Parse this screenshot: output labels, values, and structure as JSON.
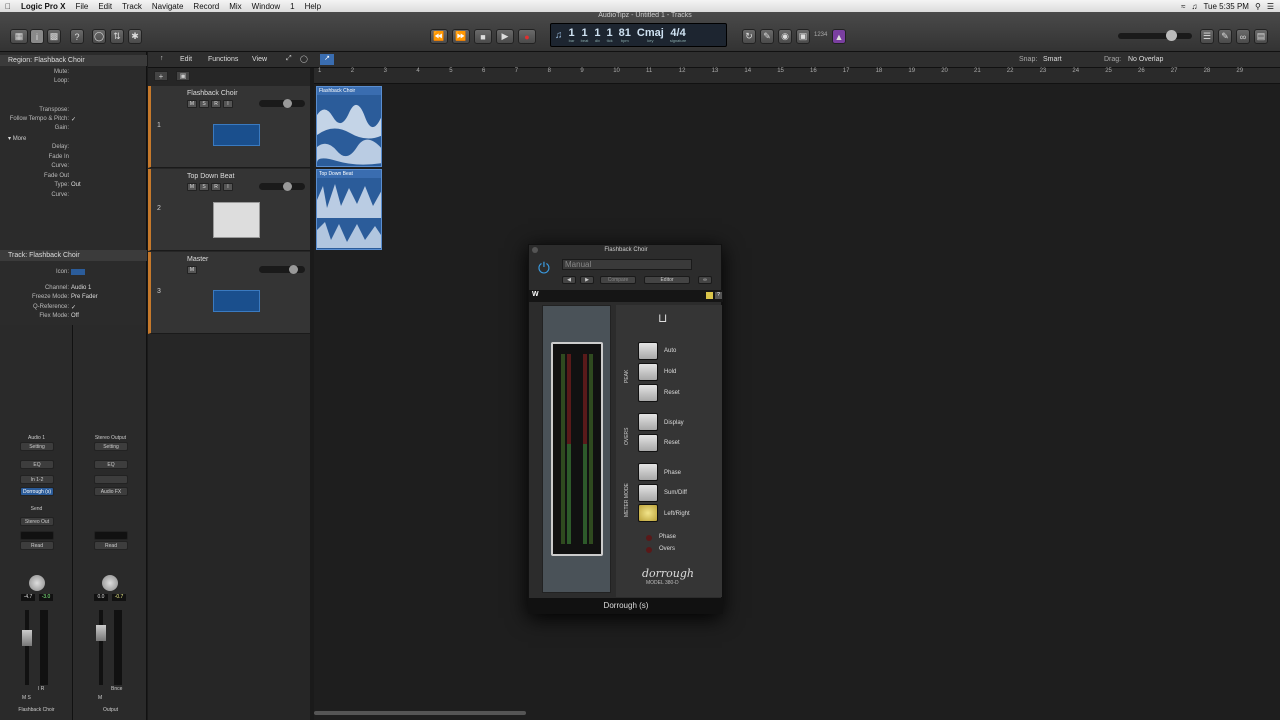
{
  "menubar": {
    "apple": "",
    "app": "Logic Pro X",
    "items": [
      "File",
      "Edit",
      "Track",
      "Navigate",
      "Record",
      "Mix",
      "Window",
      "1",
      "Help"
    ],
    "time": "Tue 5:35 PM"
  },
  "window": {
    "title": "AudioTipz - Untitled 1 - Tracks"
  },
  "lcd": {
    "bar": "1",
    "beat": "1",
    "div": "1",
    "tick": "1",
    "bpm": "81",
    "key": "Cmaj",
    "signature": "4/4",
    "lbl_bar": "bar",
    "lbl_beat": "beat",
    "lbl_div": "div",
    "lbl_tick": "tick",
    "lbl_bpm": "bpm",
    "lbl_key": "key",
    "lbl_sig": "signature"
  },
  "toolbar": {
    "cpu_label": "1234"
  },
  "tracks_menu": {
    "edit": "Edit",
    "functions": "Functions",
    "view": "View",
    "snap_label": "Snap:",
    "snap_value": "Smart",
    "drag_label": "Drag:",
    "drag_value": "No Overlap"
  },
  "inspector": {
    "region_header": "Region: Flashback Choir",
    "region_rows": [
      {
        "k": "Mute:",
        "v": ""
      },
      {
        "k": "Loop:",
        "v": ""
      },
      {
        "k": "Transpose:",
        "v": ""
      },
      {
        "k": "Follow Tempo & Pitch:",
        "v": "✓"
      },
      {
        "k": "Gain:",
        "v": ""
      },
      {
        "k": "Delay:",
        "v": ""
      },
      {
        "k": "Fade In",
        "v": ""
      },
      {
        "k": "Curve:",
        "v": ""
      },
      {
        "k": "Fade Out",
        "v": ""
      },
      {
        "k": "Type:",
        "v": "Out"
      },
      {
        "k": "Curve:",
        "v": ""
      }
    ],
    "more_label": "More",
    "track_header": "Track: Flashback Choir",
    "track_rows": [
      {
        "k": "Icon:",
        "v": ""
      },
      {
        "k": "Channel:",
        "v": "Audio 1"
      },
      {
        "k": "Freeze Mode:",
        "v": "Pre Fader"
      },
      {
        "k": "Q-Reference:",
        "v": "✓"
      },
      {
        "k": "Flex Mode:",
        "v": "Off"
      }
    ]
  },
  "strips": [
    {
      "top": "Audio 1",
      "setting": "Setting",
      "eq": "EQ",
      "input": "In 1-2",
      "plugin": "Dorrough (s)",
      "send": "Send",
      "output": "Stereo Out",
      "auto": "Read",
      "val1": "-4.7",
      "val2": "-3.0",
      "ir": "I  R",
      "ms": "M   S",
      "name": "Flashback Choir"
    },
    {
      "top": "Stereo Output",
      "setting": "Setting",
      "eq": "EQ",
      "input": "",
      "plugin": "Audio FX",
      "send": "",
      "output": "",
      "auto": "Read",
      "val1": "0.0",
      "val2": "-0.7",
      "ir": "Bnce",
      "ms": "M",
      "name": "Output"
    }
  ],
  "tracks": [
    {
      "num": "1",
      "name": "Flashback Choir",
      "buttons": [
        "M",
        "S",
        "R",
        "I"
      ],
      "level": 0.6
    },
    {
      "num": "2",
      "name": "Top Down Beat",
      "buttons": [
        "M",
        "S",
        "R",
        "I"
      ],
      "level": 0.6
    },
    {
      "num": "3",
      "name": "Master",
      "buttons": [
        "M"
      ],
      "level": 0.75
    }
  ],
  "ruler": [
    "1",
    "2",
    "3",
    "4",
    "5",
    "6",
    "7",
    "8",
    "9",
    "10",
    "11",
    "12",
    "13",
    "14",
    "15",
    "16",
    "17",
    "18",
    "19",
    "20",
    "21",
    "22",
    "23",
    "24",
    "25",
    "26",
    "27",
    "28",
    "29"
  ],
  "regions": [
    {
      "name": "Flashback Choir"
    },
    {
      "name": "Top Down Beat"
    }
  ],
  "plugin": {
    "title": "Flashback Choir",
    "preset": "Manual",
    "compare": "Compare",
    "view": "Editor",
    "brand_footer": "Dorrough (s)",
    "model": "MODEL 380-D",
    "brand": "dorrough",
    "groups": {
      "peak": "PEAK",
      "overs": "OVERS",
      "meter": "METER MODE"
    },
    "buttons": [
      "Auto",
      "Hold",
      "Reset",
      "Display",
      "Reset",
      "Phase",
      "Sum/Diff",
      "Left/Right"
    ],
    "leds": [
      "Phase",
      "Overs"
    ],
    "accent": "#d9c44a"
  }
}
